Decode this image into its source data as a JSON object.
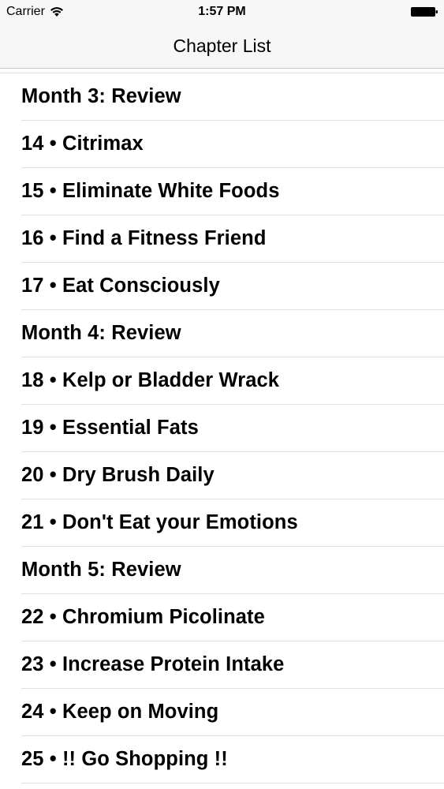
{
  "status_bar": {
    "carrier": "Carrier",
    "time": "1:57 PM"
  },
  "nav": {
    "title": "Chapter List"
  },
  "chapters": [
    {
      "label": "Month 3: Review"
    },
    {
      "label": "14 • Citrimax"
    },
    {
      "label": "15 • Eliminate White Foods"
    },
    {
      "label": "16 • Find a Fitness Friend"
    },
    {
      "label": "17 • Eat Consciously"
    },
    {
      "label": "Month 4: Review"
    },
    {
      "label": "18 • Kelp or Bladder Wrack"
    },
    {
      "label": "19 • Essential Fats"
    },
    {
      "label": "20 • Dry Brush Daily"
    },
    {
      "label": "21 • Don't Eat your Emotions"
    },
    {
      "label": "Month 5: Review"
    },
    {
      "label": "22 • Chromium Picolinate"
    },
    {
      "label": "23 • Increase Protein Intake"
    },
    {
      "label": "24 • Keep on Moving"
    },
    {
      "label": "25 • !! Go Shopping !!"
    }
  ]
}
